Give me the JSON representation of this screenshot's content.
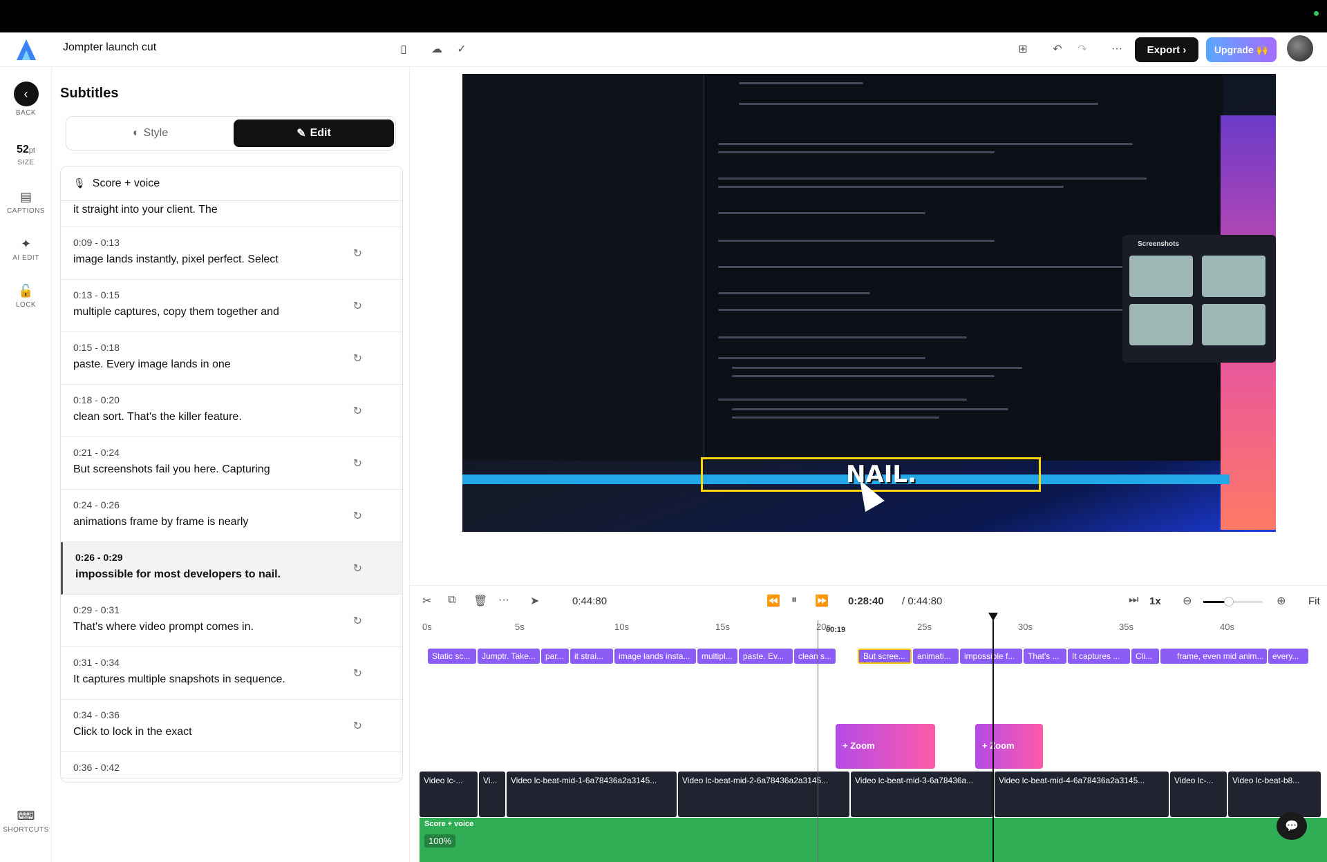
{
  "app": {
    "project_title": "Jompter launch cut",
    "accent": "#8b5cf6"
  },
  "header": {
    "export_label": "Export ›",
    "upgrade_label": "Upgrade 🙌"
  },
  "rail": {
    "back_label": "BACK",
    "size_value": "52",
    "size_unit": "pt",
    "size_label": "SIZE",
    "captions_label": "CAPTIONS",
    "ai_edit_label": "AI EDIT",
    "lock_label": "LOCK",
    "shortcuts_label": "SHORTCUTS"
  },
  "subtitles": {
    "title": "Subtitles",
    "style_tab": "Style",
    "edit_tab": "Edit",
    "track_name": "Score + voice",
    "partial_top": "it straight into your client. The",
    "items": [
      {
        "time": "0:09 - 0:13",
        "text": "image lands instantly, pixel perfect. Select"
      },
      {
        "time": "0:13 - 0:15",
        "text": "multiple captures, copy them together and"
      },
      {
        "time": "0:15 - 0:18",
        "text": "paste. Every image lands in one"
      },
      {
        "time": "0:18 - 0:20",
        "text": "clean sort. That's the killer feature."
      },
      {
        "time": "0:21 - 0:24",
        "text": "But screenshots fail you here. Capturing"
      },
      {
        "time": "0:24 - 0:26",
        "text": "animations frame by frame is nearly"
      },
      {
        "time": "0:26 - 0:29",
        "text": "impossible for most developers to nail."
      },
      {
        "time": "0:29 - 0:31",
        "text": "That's where video prompt comes in."
      },
      {
        "time": "0:31 - 0:34",
        "text": "It captures multiple snapshots in sequence."
      },
      {
        "time": "0:34 - 0:36",
        "text": "Click to lock in the exact"
      }
    ],
    "partial_bottom_time": "0:36 - 0:42"
  },
  "preview": {
    "caption_text": "NAIL.",
    "thumbs_title": "Screenshots"
  },
  "timeline": {
    "clip_duration": "0:44:80",
    "current_time": "0:28:40",
    "total_time": "/ 0:44:80",
    "speed": "1x",
    "fit_label": "Fit",
    "cut_marker": "00:19",
    "ruler": [
      "0s",
      "5s",
      "10s",
      "15s",
      "20s",
      "25s",
      "30s",
      "35s",
      "40s"
    ],
    "caption_chips": [
      "Static sc...",
      "Jumptr. Take...",
      "par...",
      "it strai...",
      "image lands insta...",
      "multipl...",
      "paste. Ev...",
      "clean s...",
      "But scree...",
      "animati...",
      "impossible f...",
      "That's ...",
      "It captures ...",
      "Cli...",
      "frame, even mid anim...",
      "every..."
    ],
    "zoom_label": "+ Zoom",
    "video_clips": [
      "Video lc-...",
      "Vi...",
      "Video lc-beat-mid-1-6a78436a2a3145...",
      "Video lc-beat-mid-2-6a78436a2a3145...",
      "Video lc-beat-mid-3-6a78436a...",
      "Video lc-beat-mid-4-6a78436a2a3145...",
      "Video lc-...",
      "Video lc-beat-b8..."
    ],
    "audio_track": "Score + voice",
    "audio_volume": "100%"
  }
}
